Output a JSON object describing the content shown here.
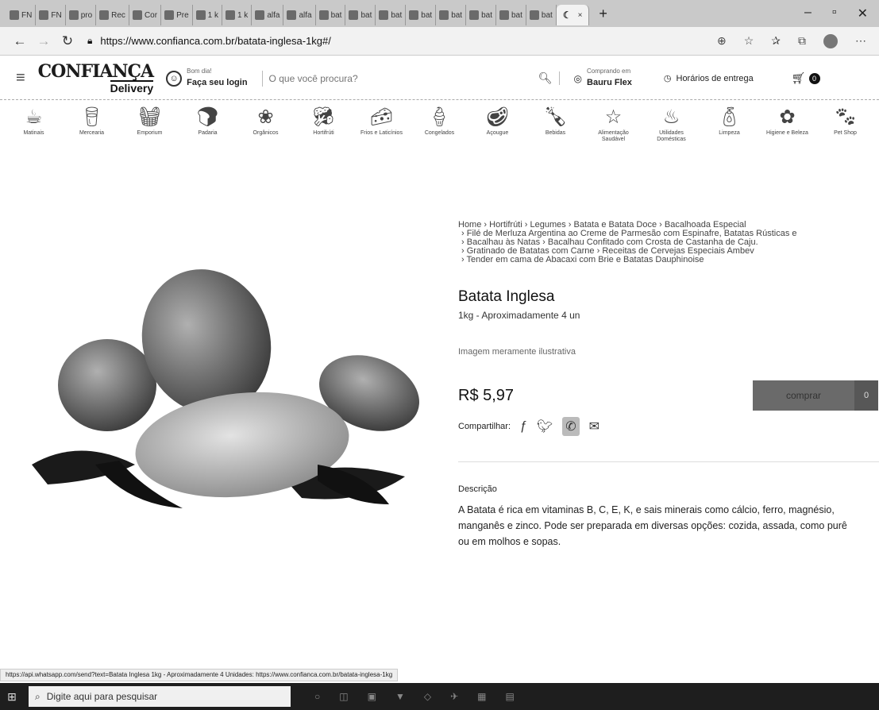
{
  "browser": {
    "tabs": [
      "FN",
      "FN",
      "pro",
      "Rec",
      "Cor",
      "Pre",
      "1 k",
      "1 k",
      "alfa",
      "alfa",
      "bat",
      "bat",
      "bat",
      "bat",
      "bat",
      "bat",
      "bat",
      "bat"
    ],
    "active_tab_close": "×",
    "new_tab": "+",
    "url": "https://www.confianca.com.br/batata-inglesa-1kg#/"
  },
  "header": {
    "logo_line1": "CONFIANÇA",
    "logo_line2": "Delivery",
    "greeting": "Bom dia!",
    "login": "Faça seu login",
    "search_placeholder": "O que você procura?",
    "city_label": "Comprando em",
    "city_name": "Bauru Flex",
    "hours": "Horários de entrega",
    "cart_count": "0"
  },
  "categories": [
    {
      "label": "Matinais",
      "icon": "coffee-cup-icon"
    },
    {
      "label": "Mercearia",
      "icon": "grocery-icon"
    },
    {
      "label": "Emporium",
      "icon": "basket-icon"
    },
    {
      "label": "Padaria",
      "icon": "bread-icon"
    },
    {
      "label": "Orgânicos",
      "icon": "leaf-icon"
    },
    {
      "label": "Hortifrúti",
      "icon": "vegetables-icon"
    },
    {
      "label": "Frios e Laticínios",
      "icon": "cheese-icon"
    },
    {
      "label": "Congelados",
      "icon": "popsicle-icon"
    },
    {
      "label": "Açougue",
      "icon": "meat-icon"
    },
    {
      "label": "Bebidas",
      "icon": "bottle-icon"
    },
    {
      "label": "Alimentação Saudável",
      "icon": "star-icon"
    },
    {
      "label": "Utilidades Domésticas",
      "icon": "pot-icon"
    },
    {
      "label": "Limpeza",
      "icon": "spray-icon"
    },
    {
      "label": "Higiene e Beleza",
      "icon": "beauty-icon"
    },
    {
      "label": "Pet Shop",
      "icon": "pet-icon"
    }
  ],
  "breadcrumb": {
    "line1": [
      "Home",
      "Hortifrúti",
      "Legumes",
      "Batata e Batata Doce",
      "Bacalhoada Especial"
    ],
    "line2": [
      "Filé de Merluza Argentina ao Creme de Parmesão com Espinafre, Batatas Rústicas e"
    ],
    "line3": [
      "Bacalhau às Natas",
      "Bacalhau Confitado com Crosta de Castanha de Caju."
    ],
    "line4": [
      "Gratinado de Batatas com Carne",
      "Receitas de Cervejas Especiais Ambev"
    ],
    "line5": [
      "Tender em cama de Abacaxi com Brie e Batatas Dauphinoise"
    ]
  },
  "product": {
    "title": "Batata Inglesa",
    "subtitle": "1kg - Aproximadamente 4 un",
    "illustrative": "Imagem meramente ilustrativa",
    "price": "R$ 5,97",
    "buy_label": "comprar",
    "buy_qty": "0",
    "share_label": "Compartilhar:",
    "description_heading": "Descrição",
    "description": "A Batata é rica em vitaminas B, C, E, K, e sais minerais como cálcio, ferro, magnésio, manganês e zinco. Pode ser preparada em diversas opções: cozida, assada, como purê ou em molhos e sopas."
  },
  "status_url": "https://api.whatsapp.com/send?text=Batata Inglesa 1kg - Aproximadamente 4 Unidades: https://www.confianca.com.br/batata-inglesa-1kg",
  "taskbar": {
    "search_placeholder": "Digite aqui para pesquisar"
  }
}
